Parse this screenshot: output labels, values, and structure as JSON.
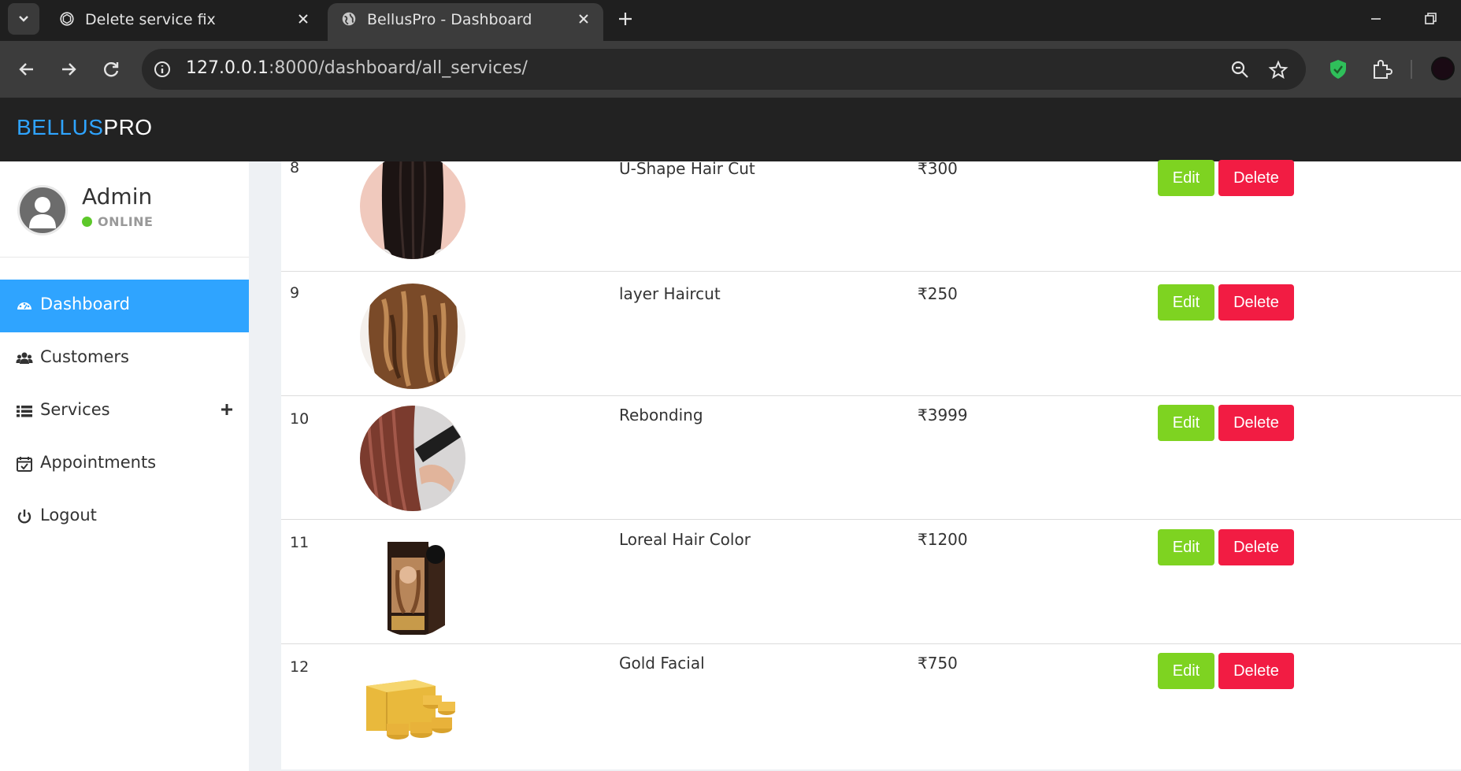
{
  "browser": {
    "tabs": [
      {
        "title": "Delete service fix",
        "active": false,
        "icon": "chatgpt-icon"
      },
      {
        "title": "BellusPro - Dashboard",
        "active": true,
        "icon": "globe-icon"
      }
    ],
    "url_host": "127.0.0.1",
    "url_rest": ":8000/dashboard/all_services/"
  },
  "app": {
    "brand_part1": "BELLUS",
    "brand_part2": "PRO",
    "colors": {
      "brand_blue": "#2fa4ff",
      "header_bg": "#222222",
      "edit_green": "#7ed321",
      "delete_red": "#f21c43",
      "online_green": "#5dc82a"
    }
  },
  "sidebar": {
    "user_name": "Admin",
    "status": "ONLINE",
    "items": [
      {
        "label": "Dashboard",
        "icon": "dashboard-icon",
        "active": true
      },
      {
        "label": "Customers",
        "icon": "users-icon"
      },
      {
        "label": "Services",
        "icon": "list-icon"
      },
      {
        "label": "Appointments",
        "icon": "calendar-check-icon"
      },
      {
        "label": "Logout",
        "icon": "power-icon"
      }
    ]
  },
  "services": {
    "edit_label": "Edit",
    "delete_label": "Delete",
    "rows": [
      {
        "id": "8",
        "name": "U-Shape Hair Cut",
        "price": "₹300"
      },
      {
        "id": "9",
        "name": "layer Haircut",
        "price": "₹250"
      },
      {
        "id": "10",
        "name": "Rebonding",
        "price": "₹3999"
      },
      {
        "id": "11",
        "name": "Loreal Hair Color",
        "price": "₹1200"
      },
      {
        "id": "12",
        "name": "Gold Facial",
        "price": "₹750"
      }
    ]
  }
}
